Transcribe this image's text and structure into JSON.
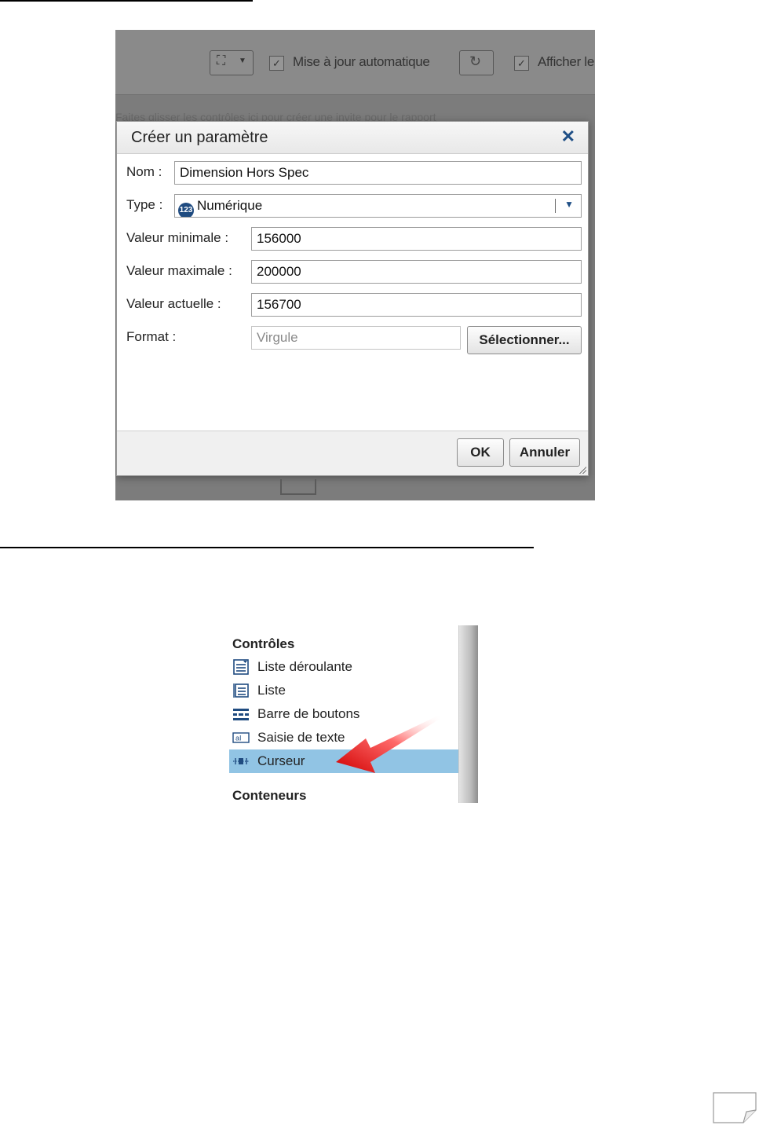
{
  "toolbar": {
    "auto_update_label": "Mise à jour automatique",
    "show_label": "Afficher le",
    "hint_text": "Faites glisser les contrôles ici pour créer une invite pour le rapport"
  },
  "dialog": {
    "title": "Créer un paramètre",
    "close_symbol": "✕",
    "fields": {
      "name": {
        "label": "Nom :",
        "value": "Dimension Hors Spec"
      },
      "type": {
        "label": "Type :",
        "value": "Numérique",
        "icon": "numeric-123-icon",
        "icon_text": "123"
      },
      "min": {
        "label": "Valeur minimale :",
        "value": "156000"
      },
      "max": {
        "label": "Valeur maximale :",
        "value": "200000"
      },
      "current": {
        "label": "Valeur actuelle :",
        "value": "156700"
      },
      "format": {
        "label": "Format :",
        "value": "Virgule",
        "button": "Sélectionner..."
      }
    },
    "footer": {
      "ok": "OK",
      "cancel": "Annuler"
    }
  },
  "controls_panel": {
    "section_controls": "Contrôles",
    "items": [
      {
        "label": "Liste déroulante",
        "icon": "dropdown-list-icon"
      },
      {
        "label": "Liste",
        "icon": "list-icon"
      },
      {
        "label": "Barre de boutons",
        "icon": "button-bar-icon"
      },
      {
        "label": "Saisie de texte",
        "icon": "text-input-icon"
      },
      {
        "label": "Curseur",
        "icon": "slider-icon",
        "selected": true
      }
    ],
    "section_containers": "Conteneurs"
  },
  "colors": {
    "accent": "#1f4f86",
    "selection": "#91c4e4",
    "arrow": "#e02424"
  }
}
